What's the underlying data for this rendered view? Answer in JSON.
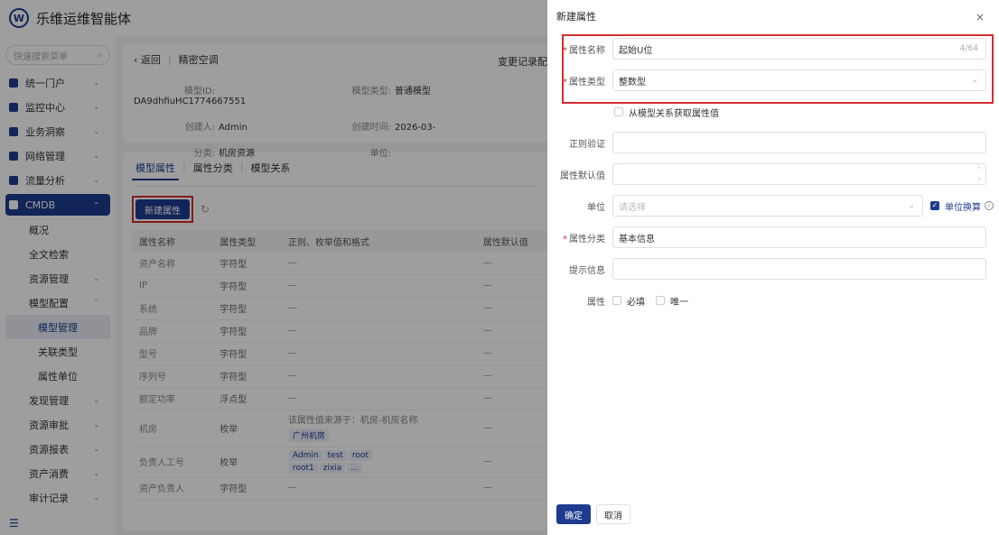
{
  "app": {
    "title": "乐维运维智能体",
    "logo_text": "W"
  },
  "sidebar": {
    "search_placeholder": "快速搜索菜单",
    "items": [
      {
        "label": "统一门户"
      },
      {
        "label": "监控中心"
      },
      {
        "label": "业务洞察"
      },
      {
        "label": "网络管理"
      },
      {
        "label": "流量分析"
      },
      {
        "label": "CMDB"
      }
    ],
    "cmdb_children": [
      {
        "label": "概况"
      },
      {
        "label": "全文检索"
      },
      {
        "label": "资源管理"
      },
      {
        "label": "模型配置"
      }
    ],
    "model_config_children": [
      {
        "label": "模型管理"
      },
      {
        "label": "关联类型"
      },
      {
        "label": "属性单位"
      }
    ],
    "more_items": [
      {
        "label": "发现管理"
      },
      {
        "label": "资源审批"
      },
      {
        "label": "资源报表"
      },
      {
        "label": "资产消费"
      },
      {
        "label": "审计记录"
      }
    ]
  },
  "header": {
    "back": "‹ 返回",
    "title": "精密空调",
    "changelog": "变更记录配"
  },
  "meta": {
    "model_id_label": "模型ID:",
    "model_id": "DA9dhfiuHC1774667551",
    "model_type_label": "模型类型:",
    "model_type": "普通模型",
    "creator_label": "创建人:",
    "creator": "Admin",
    "created_time_label": "创建时间:",
    "created_time": "2026-03-",
    "category_label": "分类:",
    "category": "机房资源",
    "unit_label": "单位:"
  },
  "tabs": [
    "模型属性",
    "属性分类",
    "模型关系"
  ],
  "new_attr_button": "新建属性",
  "table": {
    "headers": [
      "属性名称",
      "属性类型",
      "正则、枚举值和格式",
      "属性默认值"
    ],
    "rows": [
      {
        "name": "资产名称",
        "type": "字符型",
        "regex": "—",
        "default": "—"
      },
      {
        "name": "IP",
        "type": "字符型",
        "regex": "—",
        "default": "—"
      },
      {
        "name": "系统",
        "type": "字符型",
        "regex": "—",
        "default": "—"
      },
      {
        "name": "品牌",
        "type": "字符型",
        "regex": "—",
        "default": "—"
      },
      {
        "name": "型号",
        "type": "字符型",
        "regex": "—",
        "default": "—"
      },
      {
        "name": "序列号",
        "type": "字符型",
        "regex": "—",
        "default": "—"
      },
      {
        "name": "额定功率",
        "type": "浮点型",
        "regex": "—",
        "default": "—"
      }
    ],
    "room_row": {
      "name": "机房",
      "type": "枚举",
      "note": "该属性值来源于：机房-机房名称",
      "tag": "广州机房",
      "default": "—"
    },
    "owner_row": {
      "name": "负责人工号",
      "type": "枚举",
      "tags": [
        "Admin",
        "test",
        "root",
        "root1",
        "zixia",
        "..."
      ],
      "default": "—"
    },
    "last_row": {
      "name": "资产负责人",
      "type": "字符型",
      "regex": "—",
      "default": "—"
    }
  },
  "drawer": {
    "title": "新建属性",
    "close": "×",
    "fields": {
      "name_label": "属性名称",
      "name_value": "起始U位",
      "name_count": "4/64",
      "type_label": "属性类型",
      "type_value": "整数型",
      "from_relation": "从模型关系获取属性值",
      "regex_label": "正则验证",
      "default_label": "属性默认值",
      "unit_label": "单位",
      "unit_placeholder": "请选择",
      "unit_convert": "单位换算",
      "category_label": "属性分类",
      "category_value": "基本信息",
      "hint_label": "提示信息",
      "attr_label": "属性",
      "required": "必填",
      "unique": "唯一"
    },
    "ok": "确定",
    "cancel": "取消"
  },
  "colors": {
    "primary": "#1d3c8f",
    "highlight": "#d32f2f"
  }
}
